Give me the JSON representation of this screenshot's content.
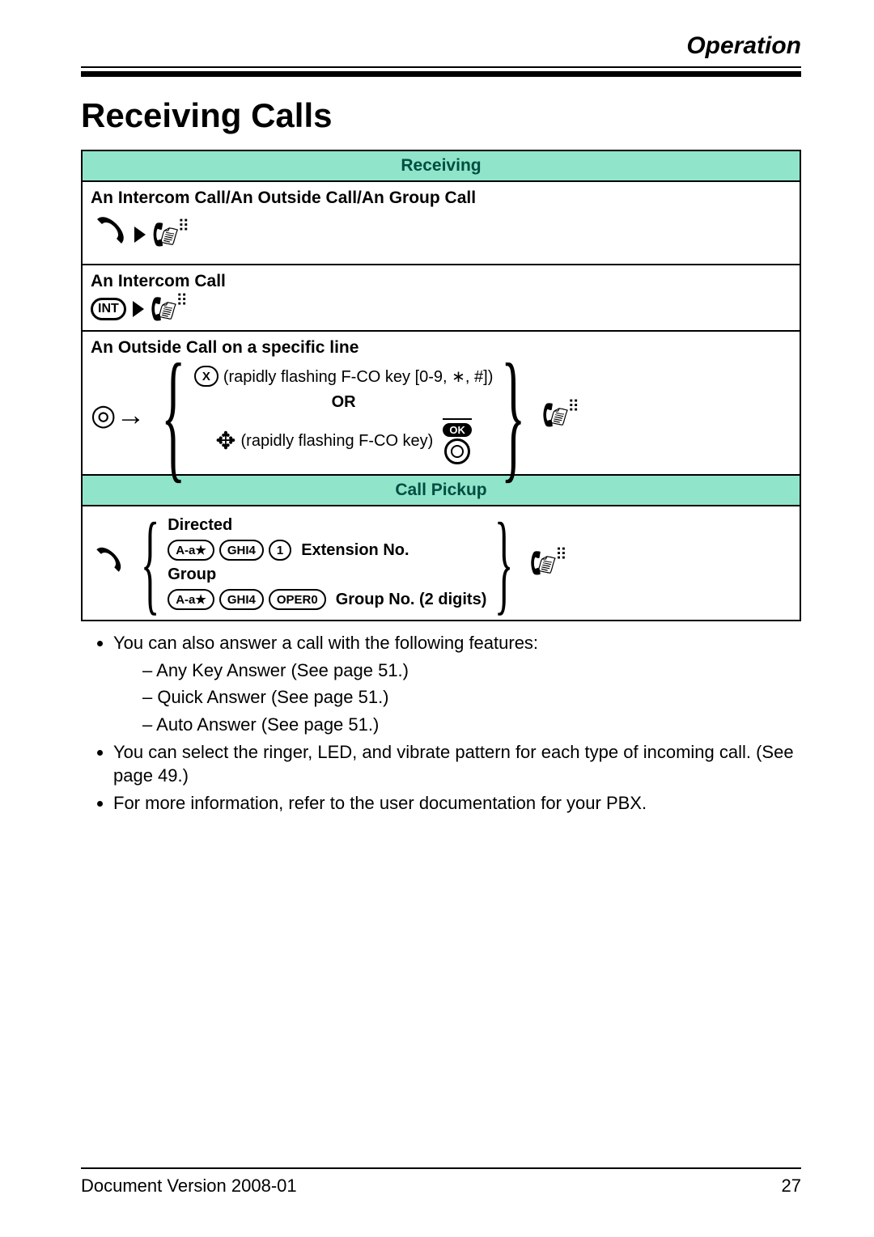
{
  "header": {
    "section": "Operation"
  },
  "title": "Receiving Calls",
  "sections": {
    "receiving": "Receiving",
    "call_pickup": "Call Pickup"
  },
  "labels": {
    "intercom_outside_group": "An Intercom Call/An Outside Call/An Group Call",
    "intercom": "An Intercom Call",
    "outside_specific": "An Outside Call on a specific line",
    "or": "OR",
    "rapid1": "(rapidly flashing F-CO key [0-9, ∗, #])",
    "rapid2": "(rapidly flashing F-CO key)",
    "directed": "Directed",
    "group": "Group",
    "ext_no": "Extension No.",
    "group_no": "Group No. (2 digits)",
    "int_badge": "INT",
    "x_key": "X",
    "ok": "OK",
    "key_star": "A-a★",
    "key_ghi4": "GHI4",
    "key_1": "1",
    "key_oper0": "OPER0"
  },
  "notes": {
    "intro": "You can also answer a call with the following features:",
    "items": [
      "Any Key Answer (See page 51.)",
      "Quick Answer (See page 51.)",
      "Auto Answer (See page 51.)"
    ],
    "ringer": "You can select the ringer, LED, and vibrate pattern for each type of incoming call. (See page 49.)",
    "pbx": "For more information, refer to the user documentation for your PBX."
  },
  "footer": {
    "doc_version": "Document Version  2008-01",
    "page_number": "27"
  }
}
